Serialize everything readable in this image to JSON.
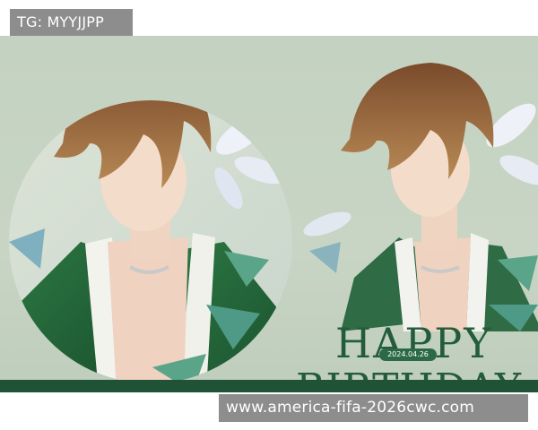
{
  "watermark_top": "TG: MYYJJPP",
  "watermark_bottom": "www.america-fifa-2026cwc.com",
  "greeting": {
    "line1": "HAPPY",
    "line2": "BIRTHDAY",
    "date_badge": "2024.04.26"
  },
  "colors": {
    "background": "#c4d2c2",
    "accent_green": "#235c3c",
    "band": "#1f5236",
    "hair": "#8a5a35",
    "watermark_bg": "#8d8d8d"
  }
}
